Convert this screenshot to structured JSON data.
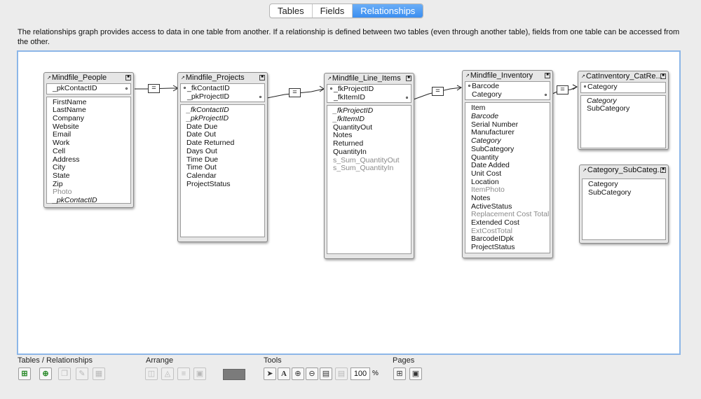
{
  "tabs": [
    {
      "label": "Tables"
    },
    {
      "label": "Fields"
    },
    {
      "label": "Relationships"
    }
  ],
  "description": "The relationships graph provides access to data in one table from another. If a relationship is defined between two tables (even through another table), fields from one table can be accessed from the other.",
  "tables": {
    "people": {
      "name": "Mindfile_People",
      "keys": [
        "_pkContactID"
      ],
      "fields": [
        "FirstName",
        "LastName",
        "Company",
        "Website",
        "Email",
        "Work",
        "Cell",
        "Address",
        "City",
        "State",
        "Zip",
        "Photo",
        "_pkContactID"
      ]
    },
    "projects": {
      "name": "Mindfile_Projects",
      "keys": [
        "_fkContactID",
        "_pkProjectID"
      ],
      "fields": [
        "_fkContactID",
        "_pkProjectID",
        "Date Due",
        "Date Out",
        "Date Returned",
        "Days Out",
        "Time Due",
        "Time Out",
        "Calendar",
        "ProjectStatus"
      ]
    },
    "line_items": {
      "name": "Mindfile_Line_Items",
      "keys": [
        "_fkProjectID",
        "_fkItemID"
      ],
      "fields": [
        "_fkProjectID",
        "_fkItemID",
        "QuantityOut",
        "Notes",
        "Returned",
        "QuantityIn",
        "s_Sum_QuantityOut",
        "s_Sum_QuantityIn"
      ]
    },
    "inventory": {
      "name": "Mindfile_Inventory",
      "keys": [
        "Barcode",
        "Category"
      ],
      "fields": [
        "Item",
        "Barcode",
        "Serial Number",
        "Manufacturer",
        "Category",
        "SubCategory",
        "Quantity",
        "Date Added",
        "Unit Cost",
        "Location",
        "ItemPhoto",
        "Notes",
        "ActiveStatus",
        "Replacement Cost Total",
        "Extended Cost",
        "ExtCostTotal",
        "BarcodeIDpk",
        "ProjectStatus"
      ]
    },
    "catinv": {
      "name": "CatInventory_CatRe...",
      "keys": [
        "Category"
      ],
      "fields": [
        "Category",
        "SubCategory"
      ]
    },
    "catsub": {
      "name": "Category_SubCateg...",
      "fields": [
        "Category",
        "SubCategory"
      ]
    }
  },
  "relationship_operators": [
    "=",
    "=",
    "=",
    "="
  ],
  "toolbar": {
    "tables_relationships_label": "Tables / Relationships",
    "arrange_label": "Arrange",
    "tools_label": "Tools",
    "pages_label": "Pages",
    "zoom_value": "100",
    "zoom_unit": "%"
  },
  "icons": {
    "add-table": "add-table-icon",
    "add-relationship": "add-relationship-icon",
    "duplicate": "duplicate-icon",
    "edit": "pencil-icon",
    "delete": "trash-icon",
    "pointer": "pointer-icon",
    "text": "text-tool-icon",
    "zoom-in": "zoom-in-icon",
    "zoom-out": "zoom-out-icon",
    "fit": "fit-window-icon",
    "note": "note-icon",
    "page-breaks": "page-breaks-icon",
    "page-setup": "page-setup-icon"
  },
  "colors": {
    "active_tab": "#3b8ef0",
    "canvas_border": "#8cb6e8",
    "color_swatch": "#7b7b7b"
  }
}
